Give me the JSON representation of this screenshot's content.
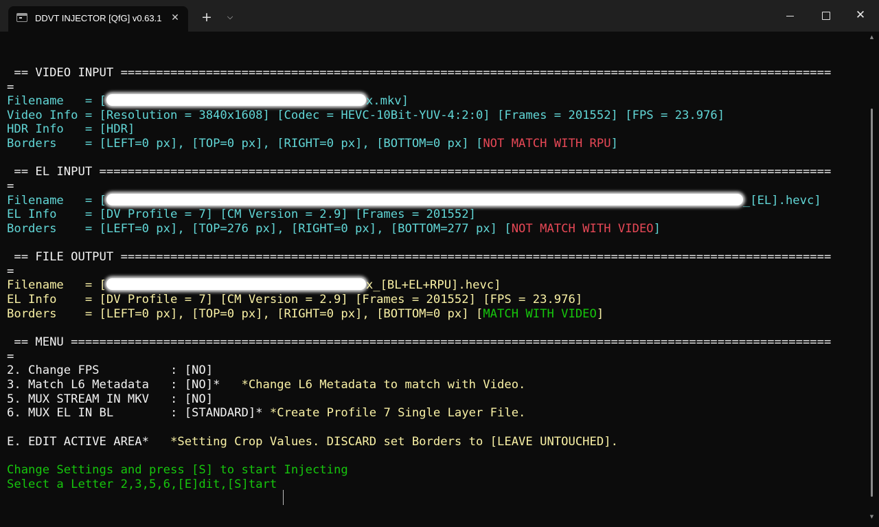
{
  "window": {
    "tab_title": "DDVT INJECTOR [QfG] v0.63.1",
    "new_tab_glyph": "+",
    "dropdown_glyph": "⌵",
    "close_glyph": "✕",
    "minimize_glyph": "—",
    "maximize_glyph": "□"
  },
  "video_input": {
    "header": " == VIDEO INPUT ====================================================================================================",
    "header_wrap": "=",
    "filename_label": "Filename   = [",
    "filename_value": "x.mkv]",
    "video_info": "Video Info = [Resolution = 3840x1608] [Codec = HEVC-10Bit-YUV-4:2:0] [Frames = 201552] [FPS = 23.976]",
    "hdr_info": "HDR Info   = [HDR]",
    "borders": "Borders    = [LEFT=0 px], [TOP=0 px], [RIGHT=0 px], [BOTTOM=0 px] [",
    "borders_status": "NOT MATCH WITH RPU",
    "borders_close": "]"
  },
  "el_input": {
    "header": " == EL INPUT =======================================================================================================",
    "header_wrap": "=",
    "filename_label": "Filename   = [",
    "filename_value": "_[EL].hevc]",
    "el_info": "EL Info    = [DV Profile = 7] [CM Version = 2.9] [Frames = 201552]",
    "borders": "Borders    = [LEFT=0 px], [TOP=276 px], [RIGHT=0 px], [BOTTOM=277 px] [",
    "borders_status": "NOT MATCH WITH VIDEO",
    "borders_close": "]"
  },
  "file_output": {
    "header": " == FILE OUTPUT ====================================================================================================",
    "header_wrap": "=",
    "filename_label": "Filename   = [",
    "filename_value": "x_[BL+EL+RPU].hevc]",
    "el_info": "EL Info    = [DV Profile = 7] [CM Version = 2.9] [Frames = 201552] [FPS = 23.976]",
    "borders": "Borders    = [LEFT=0 px], [TOP=0 px], [RIGHT=0 px], [BOTTOM=0 px] [",
    "borders_status": "MATCH WITH VIDEO",
    "borders_close": "]"
  },
  "menu": {
    "header": " == MENU ===========================================================================================================",
    "header_wrap": "=",
    "items": [
      {
        "label": "2. Change FPS          : [NO]",
        "note": ""
      },
      {
        "label": "3. Match L6 Metadata   : [NO]*",
        "note": "   *Change L6 Metadata to match with Video."
      },
      {
        "label": "5. MUX STREAM IN MKV   : [NO]",
        "note": ""
      },
      {
        "label": "6. MUX EL IN BL        : [STANDARD]*",
        "note": " *Create Profile 7 Single Layer File."
      }
    ],
    "edit_label": "E. EDIT ACTIVE AREA*",
    "edit_note": "   *Setting Crop Values. DISCARD set Borders to [LEAVE UNTOUCHED]."
  },
  "prompt": {
    "line1": "Change Settings and press [S] to start Injecting",
    "line2": "Select a Letter 2,3,5,6,[E]dit,[S]tart"
  },
  "colors": {
    "background": "#0c0c0c",
    "cyan": "#61d6d6",
    "yellow": "#f9f1a5",
    "white": "#f2f2f2",
    "green": "#16c60c",
    "red": "#e74856"
  }
}
